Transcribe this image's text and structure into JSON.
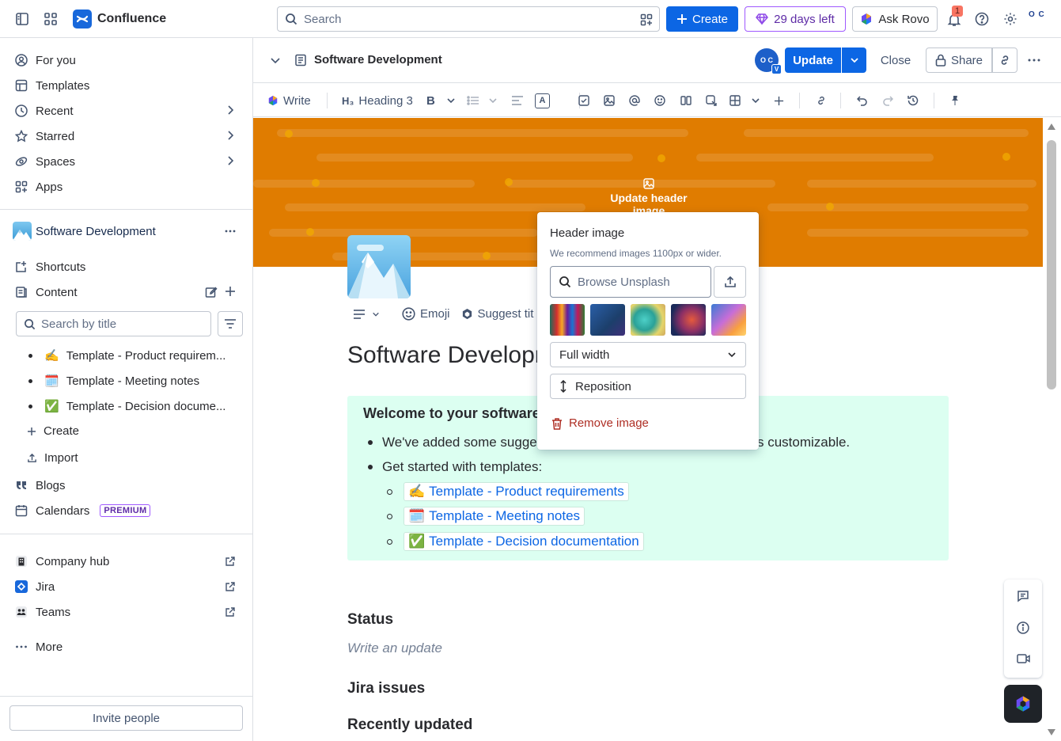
{
  "topbar": {
    "app_name": "Confluence",
    "search_placeholder": "Search",
    "create_label": "Create",
    "trial_label": "29 days left",
    "rovo_label": "Ask Rovo",
    "notification_count": "1",
    "avatar_initials": "O C"
  },
  "sidebar": {
    "nav": [
      {
        "label": "For you",
        "icon": "person-circle-icon"
      },
      {
        "label": "Templates",
        "icon": "templates-icon"
      },
      {
        "label": "Recent",
        "icon": "clock-icon"
      },
      {
        "label": "Starred",
        "icon": "star-icon"
      },
      {
        "label": "Spaces",
        "icon": "spaces-icon"
      },
      {
        "label": "Apps",
        "icon": "apps-icon"
      }
    ],
    "space_name": "Software Development",
    "shortcuts_label": "Shortcuts",
    "content_label": "Content",
    "title_search_placeholder": "Search by title",
    "tree": [
      {
        "emoji": "✍️",
        "label": "Template - Product requirem..."
      },
      {
        "emoji": "🗓️",
        "label": "Template - Meeting notes"
      },
      {
        "emoji": "✅",
        "label": "Template - Decision docume..."
      }
    ],
    "create_label": "Create",
    "import_label": "Import",
    "blogs_label": "Blogs",
    "calendars_label": "Calendars",
    "premium_badge": "PREMIUM",
    "apps": [
      {
        "label": "Company hub"
      },
      {
        "label": "Jira"
      },
      {
        "label": "Teams"
      }
    ],
    "more_label": "More",
    "invite_label": "Invite people"
  },
  "pagebar": {
    "title": "Software Development",
    "collaborator_initials": "O C",
    "collaborator_badge": "V",
    "update_label": "Update",
    "close_label": "Close",
    "share_label": "Share"
  },
  "toolbar": {
    "write_label": "Write",
    "heading_label": "Heading 3"
  },
  "header": {
    "update_header_label": "Update header image",
    "banner_color": "#e07c00"
  },
  "page": {
    "emoji_label": "Emoji",
    "suggest_label": "Suggest tit",
    "title": "Software Developm",
    "panel_heading": "Welcome to your software",
    "bullet1_left": "We've added some sugge",
    "bullet1_right": "s customizable.",
    "bullet2": "Get started with templates:",
    "links": [
      {
        "emoji": "✍️",
        "label": "Template - Product requirements"
      },
      {
        "emoji": "🗓️",
        "label": "Template - Meeting notes"
      },
      {
        "emoji": "✅",
        "label": "Template - Decision documentation"
      }
    ],
    "status_heading": "Status",
    "status_placeholder": "Write an update",
    "jira_heading": "Jira issues",
    "recent_heading": "Recently updated"
  },
  "popup": {
    "title": "Header image",
    "subtitle": "We recommend images 1100px or wider.",
    "search_placeholder": "Browse Unsplash",
    "width_option": "Full width",
    "reposition_label": "Reposition",
    "remove_label": "Remove image"
  }
}
